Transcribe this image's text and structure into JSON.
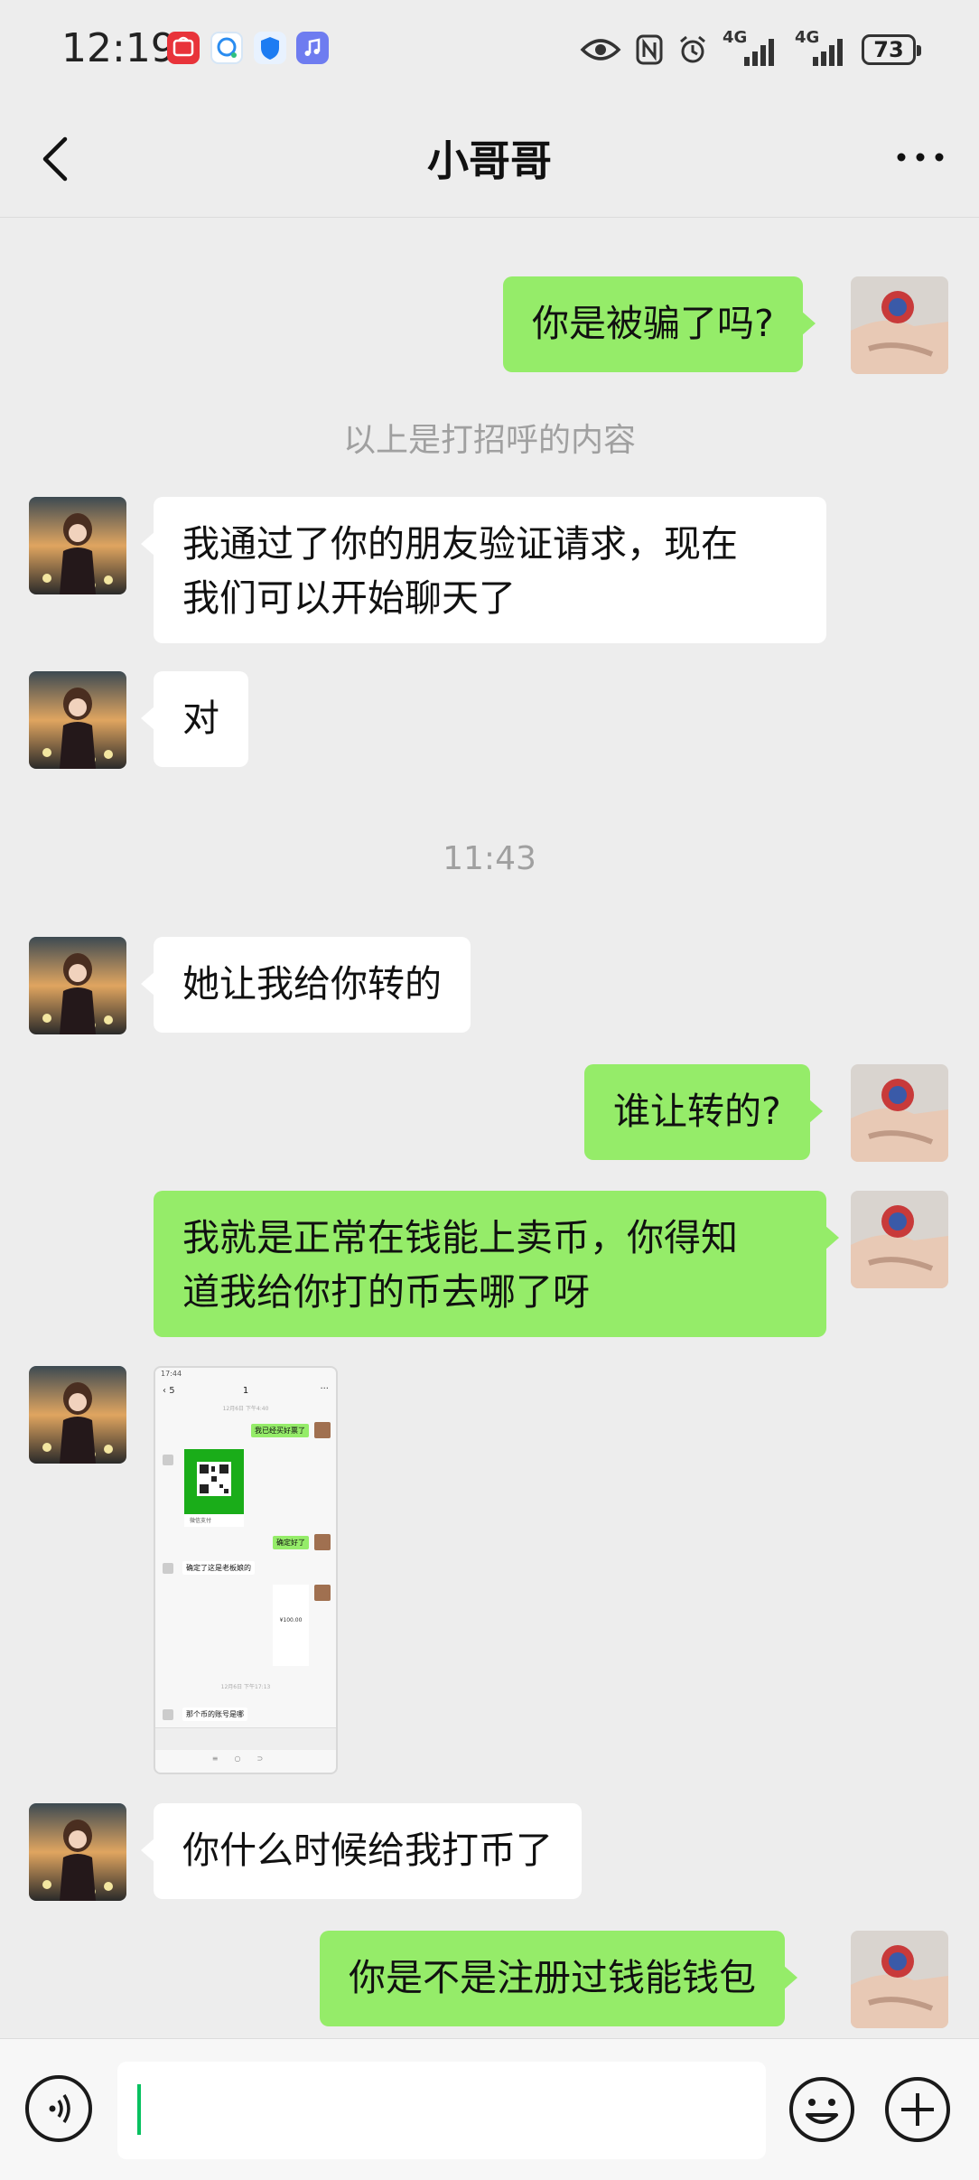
{
  "status_bar": {
    "time": "12:19",
    "network_1": "4G",
    "network_2": "4G",
    "battery": "73",
    "app_icons": [
      "huawei-store-icon",
      "chat-app-icon",
      "shield-app-icon",
      "music-app-icon"
    ]
  },
  "nav": {
    "title": "小哥哥"
  },
  "messages": [
    {
      "side": "out",
      "text": "你是被骗了吗?"
    },
    {
      "system": "以上是打招呼的内容"
    },
    {
      "side": "in",
      "text": "我通过了你的朋友验证请求，现在\n我们可以开始聊天了"
    },
    {
      "side": "in",
      "text": "对"
    },
    {
      "system": "11:43"
    },
    {
      "side": "in",
      "text": "她让我给你转的"
    },
    {
      "side": "out",
      "text": "谁让转的?"
    },
    {
      "side": "out",
      "text": "我就是正常在钱能上卖币，你得知\n道我给你打的币去哪了呀"
    },
    {
      "side": "in",
      "type": "image",
      "label": "screenshot-image"
    },
    {
      "side": "in",
      "text": "你什么时候给我打币了"
    },
    {
      "side": "out",
      "text": "你是不是注册过钱能钱包"
    }
  ],
  "screenshot": {
    "time": "17:44",
    "back_count": "5",
    "title": "1",
    "timestamp_1": "12月6日 下午4:40",
    "msg_1": "我已经买好票了",
    "pay_label": "微信支付",
    "msg_2": "确定好了",
    "msg_3": "确定了这是老板娘的",
    "amount": "¥100.00",
    "timestamp_2": "12月6日 下午17:13",
    "msg_4": "那个币的账号是哪"
  },
  "colors": {
    "outgoing_bubble": "#95ec69",
    "incoming_bubble": "#ffffff",
    "background": "#ededed",
    "caret": "#07c160"
  }
}
